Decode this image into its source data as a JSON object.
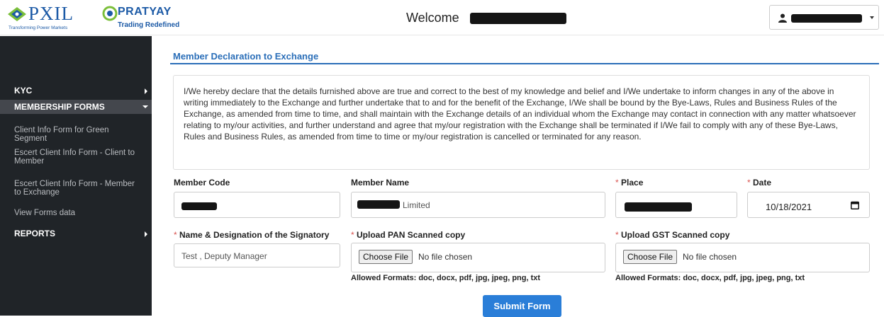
{
  "header": {
    "pxil_logo_text": "PXIL",
    "pxil_tagline": "Transforming Power Markets",
    "pratyay_logo_text": "PRATYAY",
    "pratyay_tagline": "Trading Redefined",
    "welcome_label": "Welcome",
    "user_menu_icon": "user-icon",
    "dropdown_icon": "caret-down-icon"
  },
  "sidebar": {
    "items": [
      {
        "label": "KYC",
        "icon": "chevron-right-icon"
      },
      {
        "label": "MEMBERSHIP FORMS",
        "icon": "caret-down-icon"
      },
      {
        "label": "Client Info Form for Green Segment"
      },
      {
        "label": "Escert Client Info Form - Client to Member"
      },
      {
        "label": "Escert Client Info Form - Member to Exchange"
      },
      {
        "label": "View Forms data"
      },
      {
        "label": "REPORTS",
        "icon": "chevron-right-icon"
      }
    ]
  },
  "form": {
    "section_title": "Member Declaration to Exchange",
    "declaration": "I/We hereby declare that the details furnished above are true and correct to the best of my knowledge and belief and I/We undertake to inform changes in any of the above in writing immediately to the Exchange and further undertake that to and for the benefit of the Exchange, I/We shall be bound by the Bye-Laws, Rules and Business Rules of the Exchange, as amended from time to time, and shall maintain with the Exchange details of an individual whom the Exchange may contact in connection with any matter whatsoever relating to my/our activities, and further understand and agree that my/our registration with the Exchange shall be terminated if I/We fail to comply with any of these Bye-Laws, Rules and Business Rules, as amended from time to time or my/our registration is cancelled or terminated for any reason.",
    "required_mark": "*",
    "member_code_label": "Member Code",
    "member_name_label": "Member Name",
    "member_name_value": "Limited",
    "place_label": "Place",
    "date_label": "Date",
    "date_value": "10/18/2021",
    "signatory_label": "Name & Designation of the Signatory",
    "signatory_value": "Test , Deputy Manager",
    "pan_label": "Upload PAN Scanned copy",
    "gst_label": "Upload GST Scanned copy",
    "choose_file_label": "Choose File",
    "no_file_label": "No file chosen",
    "allowed_formats": "Allowed Formats: doc, docx, pdf, jpg, jpeg, png, txt",
    "submit_label": "Submit Form",
    "calendar_icon": "calendar-icon"
  },
  "colors": {
    "sidebar_bg": "#202428",
    "accent": "#2a6eb8",
    "submit_bg": "#2a7ed8",
    "required": "#d9534f"
  }
}
